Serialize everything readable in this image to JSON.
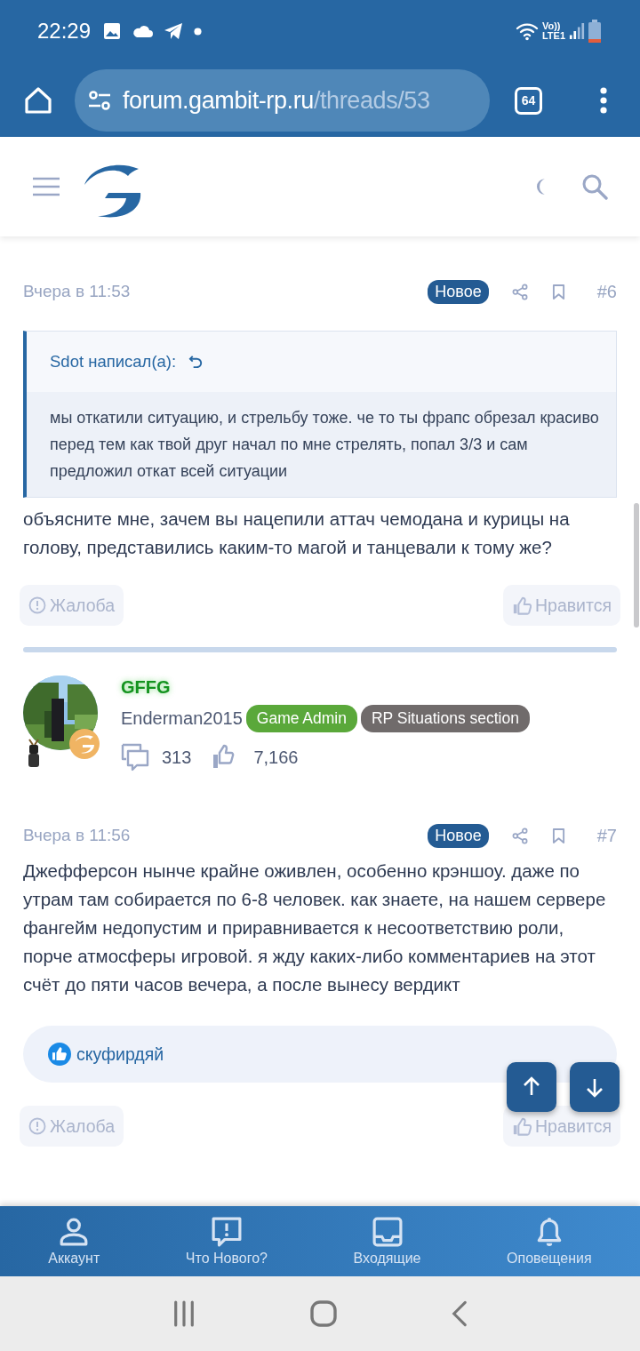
{
  "status_bar": {
    "time": "22:29",
    "network": [
      "Vo))",
      "LTE1"
    ]
  },
  "browser": {
    "url_host": "forum.gambit-rp.ru",
    "url_path": "/threads/53",
    "tab_count": "64"
  },
  "posts": [
    {
      "date": "Вчера в 11:53",
      "is_new": true,
      "new_label": "Новое",
      "number": "#6",
      "quote": {
        "author": "Sdot написал(а):",
        "text": "мы откатили ситуацию, и стрельбу тоже. че то ты фрапс обрезал красиво перед тем как твой друг начал по мне стрелять, попал 3/3 и сам предложил откат всей ситуации"
      },
      "text": "объясните мне, зачем вы нацепили аттач чемодана и курицы на голову, представились каким-то магой и танцевали к тому же?",
      "actions": [
        "Жалоба",
        "Нравится"
      ]
    },
    {
      "author": {
        "title": "GFFG",
        "name": "Enderman2015",
        "banners": [
          {
            "text": "Game Admin",
            "color": "#5aa83a"
          },
          {
            "text": "RP Situations section",
            "color": "#706b6b"
          }
        ],
        "messages": "313",
        "reactions": "7,166"
      },
      "date": "Вчера в 11:56",
      "is_new": true,
      "new_label": "Новое",
      "number": "#7",
      "text": "Джефферсон нынче крайне оживлен, особенно крэншоу. даже по утрам там собирается по 6-8 человек. как знаете, на нашем сервере фангейм недопустим и приравнивается к несоответствию роли, порче атмосферы игровой. я жду каких-либо комментариев на этот счёт до пяти часов вечера, а после вынесу вердикт",
      "reactions": [
        "скуфирдяй"
      ],
      "actions": [
        "Жалоба",
        "Нравится"
      ]
    }
  ],
  "bottom_nav": [
    {
      "label": "Аккаунт",
      "kind": "account"
    },
    {
      "label": "Что Нового?",
      "kind": "news"
    },
    {
      "label": "Входящие",
      "kind": "inbox"
    },
    {
      "label": "Оповещения",
      "kind": "alerts"
    }
  ]
}
